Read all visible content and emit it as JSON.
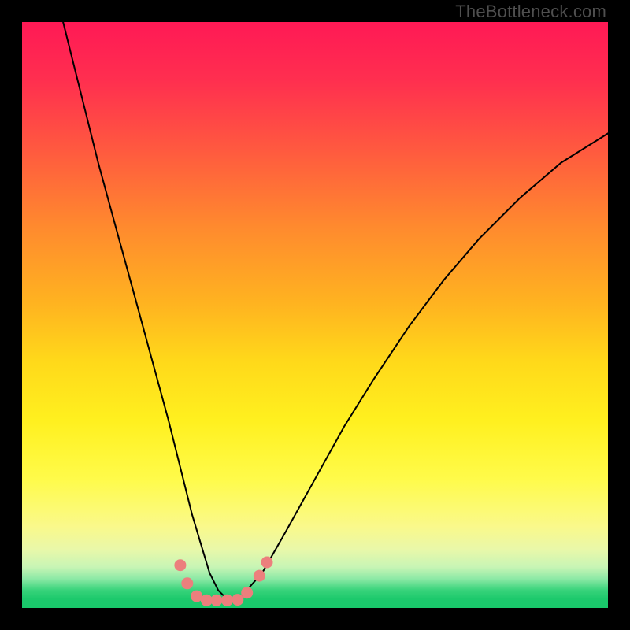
{
  "watermark": "TheBottleneck.com",
  "chart_data": {
    "type": "line",
    "title": "",
    "xlabel": "",
    "ylabel": "",
    "xlim": [
      0,
      100
    ],
    "ylim": [
      0,
      100
    ],
    "grid": false,
    "legend": false,
    "series": [
      {
        "name": "curve",
        "color": "#000000",
        "x": [
          7,
          10,
          13,
          16,
          19,
          22,
          25,
          27,
          29,
          30.5,
          32,
          33.5,
          35,
          37,
          41,
          45,
          50,
          55,
          60,
          66,
          72,
          78,
          85,
          92,
          100
        ],
        "y": [
          100,
          88,
          76,
          65,
          54,
          43,
          32,
          24,
          16,
          11,
          6,
          3,
          1.5,
          1.5,
          6,
          13,
          22,
          31,
          39,
          48,
          56,
          63,
          70,
          76,
          81
        ]
      }
    ],
    "markers": [
      {
        "name": "dot",
        "color": "#ec7f7d",
        "x": 27.0,
        "y": 7.3
      },
      {
        "name": "dot",
        "color": "#ec7f7d",
        "x": 28.2,
        "y": 4.2
      },
      {
        "name": "dot",
        "color": "#ec7f7d",
        "x": 29.8,
        "y": 2.0
      },
      {
        "name": "dot",
        "color": "#ec7f7d",
        "x": 31.5,
        "y": 1.3
      },
      {
        "name": "dot",
        "color": "#ec7f7d",
        "x": 33.2,
        "y": 1.3
      },
      {
        "name": "dot",
        "color": "#ec7f7d",
        "x": 35.0,
        "y": 1.3
      },
      {
        "name": "dot",
        "color": "#ec7f7d",
        "x": 36.8,
        "y": 1.4
      },
      {
        "name": "dot",
        "color": "#ec7f7d",
        "x": 38.4,
        "y": 2.6
      },
      {
        "name": "dot",
        "color": "#ec7f7d",
        "x": 40.5,
        "y": 5.5
      },
      {
        "name": "dot",
        "color": "#ec7f7d",
        "x": 41.8,
        "y": 7.8
      }
    ],
    "background_gradient": {
      "orientation": "vertical",
      "stops": [
        {
          "pos": 0.0,
          "color": "#ff1955"
        },
        {
          "pos": 0.35,
          "color": "#ff8a2e"
        },
        {
          "pos": 0.68,
          "color": "#fff01f"
        },
        {
          "pos": 0.93,
          "color": "#c8f5b5"
        },
        {
          "pos": 1.0,
          "color": "#19c96b"
        }
      ]
    }
  }
}
